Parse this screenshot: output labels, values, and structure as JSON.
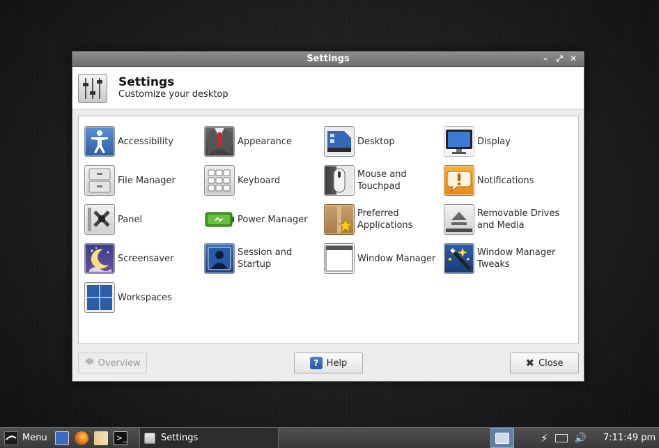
{
  "window": {
    "title": "Settings",
    "controls": {
      "minimize": "–",
      "maximize": "⤢",
      "close": "✕"
    }
  },
  "header": {
    "title": "Settings",
    "subtitle": "Customize your desktop"
  },
  "items": [
    {
      "id": "accessibility",
      "label": "Accessibility",
      "icon": "accessibility-icon"
    },
    {
      "id": "appearance",
      "label": "Appearance",
      "icon": "appearance-icon"
    },
    {
      "id": "desktop",
      "label": "Desktop",
      "icon": "desktop-icon"
    },
    {
      "id": "display",
      "label": "Display",
      "icon": "display-icon"
    },
    {
      "id": "file-manager",
      "label": "File Manager",
      "icon": "file-manager-icon"
    },
    {
      "id": "keyboard",
      "label": "Keyboard",
      "icon": "keyboard-icon"
    },
    {
      "id": "mouse",
      "label": "Mouse and Touchpad",
      "icon": "mouse-icon"
    },
    {
      "id": "notifications",
      "label": "Notifications",
      "icon": "notifications-icon"
    },
    {
      "id": "panel",
      "label": "Panel",
      "icon": "panel-icon"
    },
    {
      "id": "power-manager",
      "label": "Power Manager",
      "icon": "battery-icon"
    },
    {
      "id": "preferred-applications",
      "label": "Preferred Applications",
      "icon": "package-star-icon"
    },
    {
      "id": "removable-drives",
      "label": "Removable Drives and Media",
      "icon": "eject-icon"
    },
    {
      "id": "screensaver",
      "label": "Screensaver",
      "icon": "screensaver-moon-icon"
    },
    {
      "id": "session",
      "label": "Session and Startup",
      "icon": "user-silhouette-icon"
    },
    {
      "id": "window-manager",
      "label": "Window Manager",
      "icon": "window-icon"
    },
    {
      "id": "wm-tweaks",
      "label": "Window Manager Tweaks",
      "icon": "magic-wand-icon"
    },
    {
      "id": "workspaces",
      "label": "Workspaces",
      "icon": "workspaces-icon"
    }
  ],
  "footer": {
    "overview": "Overview",
    "help": "Help",
    "close": "Close"
  },
  "taskbar": {
    "menu": "Menu",
    "task": "Settings",
    "clock": "7:11:49 pm"
  }
}
